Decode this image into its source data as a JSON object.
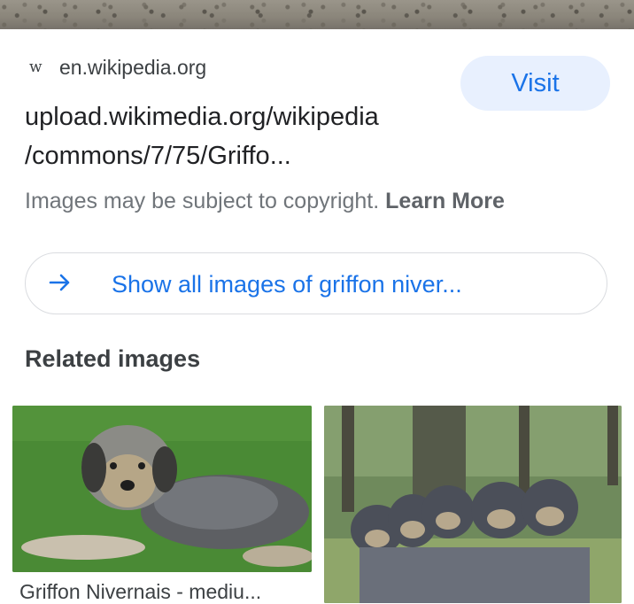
{
  "result": {
    "source_icon": "w",
    "source_domain": "en.wikipedia.org",
    "visit_label": "Visit",
    "url_line1": "upload.wikimedia.org/wikipedia",
    "url_line2": "/commons/7/75/Griffo...",
    "copyright_text": "Images may be subject to copyright.",
    "learn_more_label": "Learn More"
  },
  "show_all": {
    "icon": "arrow-right-icon",
    "label": "Show all images of griffon niver..."
  },
  "related": {
    "heading": "Related images",
    "items": [
      {
        "caption": "Griffon Nivernais - mediu...",
        "image": "single-griffon-dog-on-grass"
      },
      {
        "caption": "",
        "image": "group-of-griffon-dogs-in-forest"
      }
    ]
  },
  "colors": {
    "accent": "#1a73e8",
    "visit_bg": "#e8f0fe",
    "muted_text": "#70757a"
  }
}
